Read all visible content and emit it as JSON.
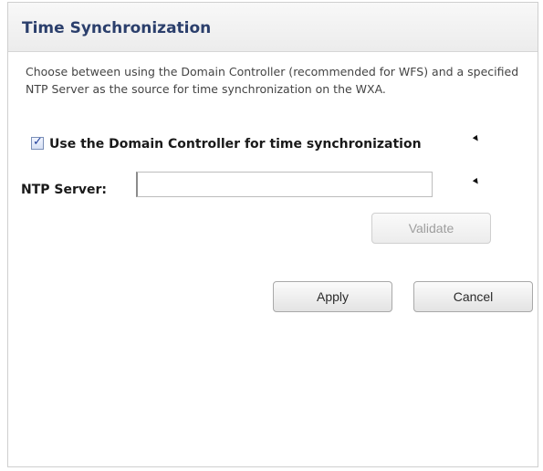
{
  "panel": {
    "title": "Time Synchronization",
    "description": "Choose between using the Domain Controller (recommended for WFS) and a specified NTP Server as the source for time synchronization on the WXA."
  },
  "form": {
    "use_domain_controller": {
      "label": "Use the Domain Controller for time synchronization",
      "checked": true
    },
    "ntp_server": {
      "label": "NTP Server:",
      "value": ""
    },
    "validate_label": "Validate"
  },
  "actions": {
    "apply_label": "Apply",
    "cancel_label": "Cancel"
  },
  "colors": {
    "title": "#2b3f6c",
    "checkbox_accent": "#22409a",
    "disabled_text": "#9e9e9e"
  }
}
